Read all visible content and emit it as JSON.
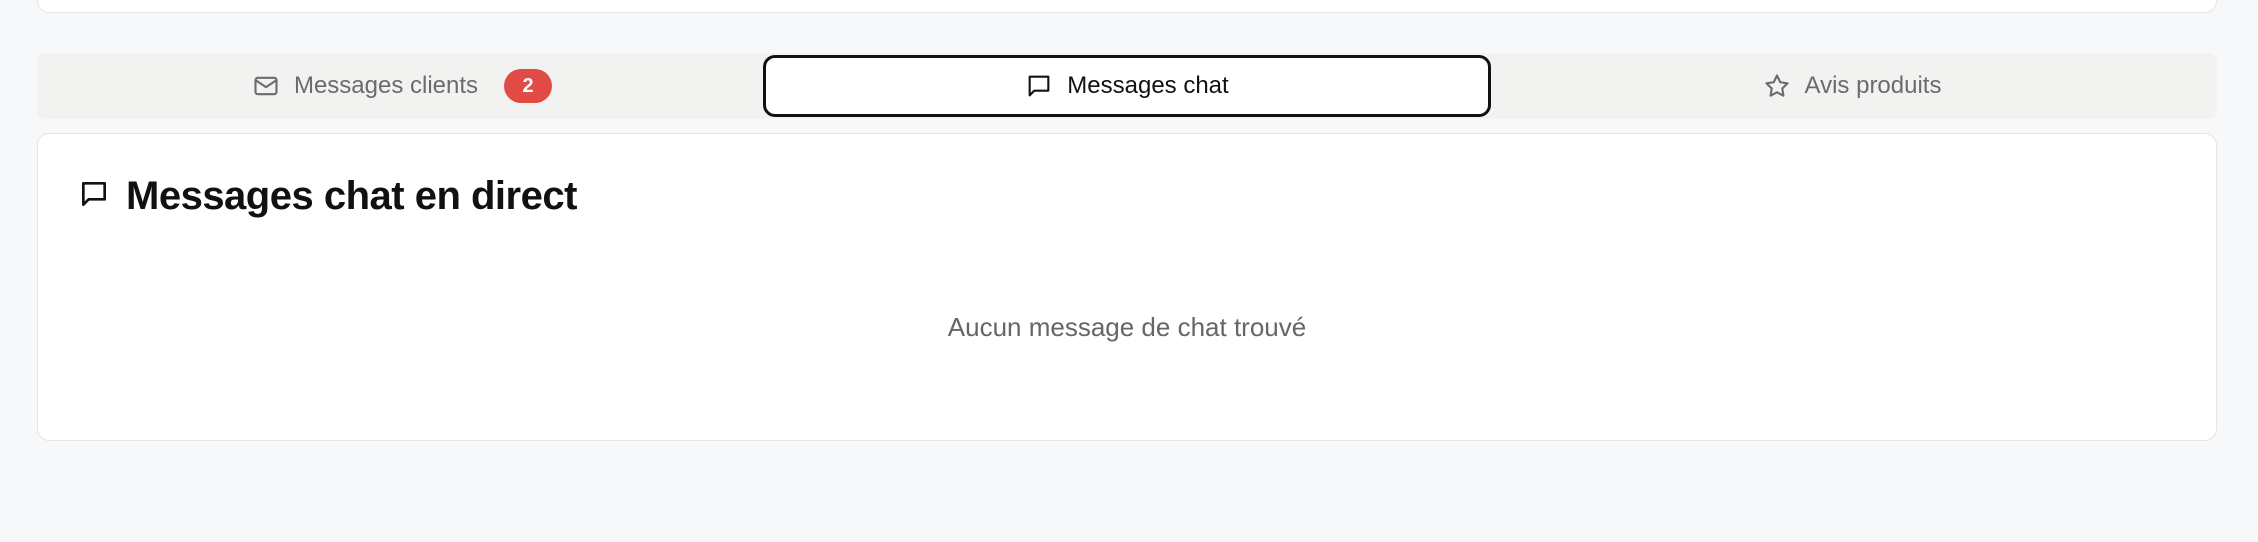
{
  "tabs": [
    {
      "label": "Messages clients",
      "icon": "mail-icon",
      "badge": "2",
      "active": false
    },
    {
      "label": "Messages chat",
      "icon": "chat-bubble-icon",
      "active": true
    },
    {
      "label": "Avis produits",
      "icon": "star-icon",
      "active": false
    }
  ],
  "panel": {
    "icon": "chat-bubble-icon",
    "title": "Messages chat en direct",
    "empty_text": "Aucun message de chat trouvé"
  },
  "colors": {
    "badge": "#e24b45",
    "active_border": "#111111",
    "background": "#f7f8fa"
  }
}
